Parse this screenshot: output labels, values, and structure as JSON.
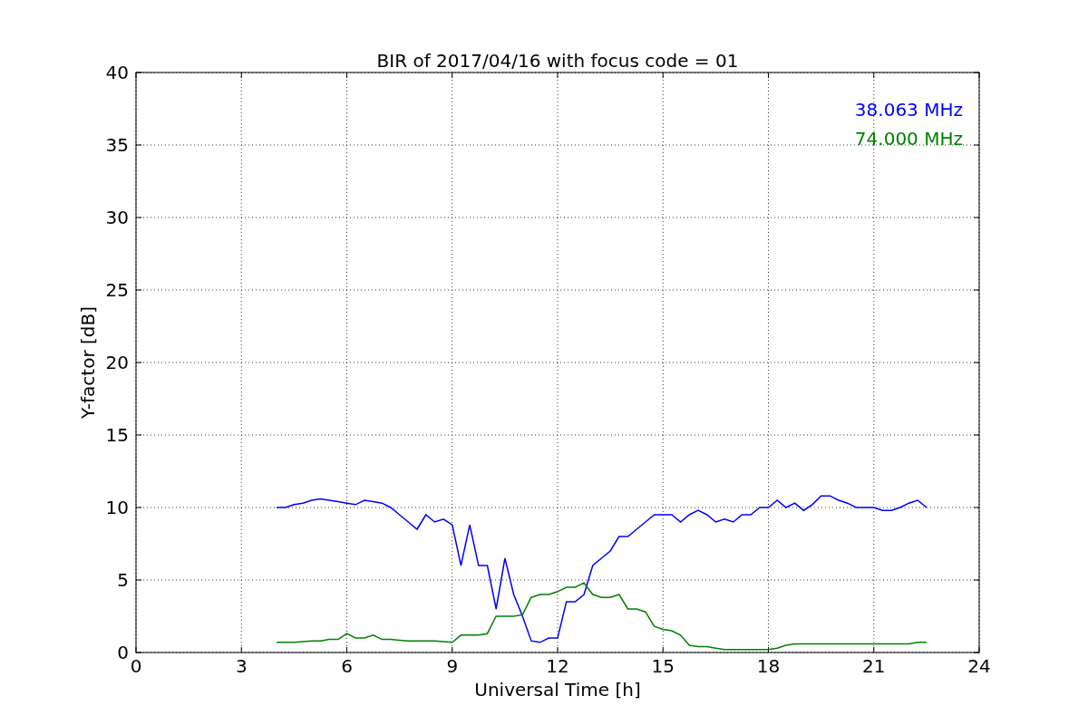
{
  "figure": {
    "chart_data": {
      "type": "line",
      "title": "BIR of 2017/04/16 with focus code = 01",
      "xlabel": "Universal Time [h]",
      "ylabel": "Y-factor [dB]",
      "x": [
        4,
        4.25,
        4.5,
        4.75,
        5,
        5.25,
        5.5,
        5.75,
        6,
        6.25,
        6.5,
        6.75,
        7,
        7.25,
        7.5,
        7.75,
        8,
        8.25,
        8.5,
        8.75,
        9,
        9.25,
        9.5,
        9.75,
        10,
        10.25,
        10.5,
        10.75,
        11,
        11.25,
        11.5,
        11.75,
        12,
        12.25,
        12.5,
        12.75,
        13,
        13.25,
        13.5,
        13.75,
        14,
        14.25,
        14.5,
        14.75,
        15,
        15.25,
        15.5,
        15.75,
        16,
        16.25,
        16.5,
        16.75,
        17,
        17.25,
        17.5,
        17.75,
        18,
        18.25,
        18.5,
        18.75,
        19,
        19.25,
        19.5,
        19.75,
        20,
        20.25,
        20.5,
        20.75,
        21,
        21.25,
        21.5,
        21.75,
        22,
        22.25,
        22.5
      ],
      "series": [
        {
          "name": "38.063 MHz",
          "color": "#0000ff",
          "values": [
            10,
            10,
            10.2,
            10.3,
            10.5,
            10.6,
            10.5,
            10.4,
            10.3,
            10.2,
            10.5,
            10.4,
            10.3,
            10,
            9.5,
            9,
            8.5,
            9.5,
            9,
            9.2,
            8.8,
            6,
            8.8,
            6,
            6,
            3,
            6.5,
            4,
            2.5,
            0.8,
            0.7,
            1,
            1,
            3.5,
            3.5,
            4,
            6,
            6.5,
            7,
            8,
            8,
            8.5,
            9,
            9.5,
            9.5,
            9.5,
            9,
            9.5,
            9.8,
            9.5,
            9,
            9.2,
            9,
            9.5,
            9.5,
            10,
            10,
            10.5,
            10,
            10.3,
            9.8,
            10.2,
            10.8,
            10.8,
            10.5,
            10.3,
            10,
            10,
            10,
            9.8,
            9.8,
            10,
            10.3,
            10.5,
            10
          ]
        },
        {
          "name": "74.000 MHz",
          "color": "#008000",
          "values": [
            0.7,
            0.7,
            0.7,
            0.75,
            0.8,
            0.8,
            0.9,
            0.9,
            1.3,
            1,
            1,
            1.2,
            0.9,
            0.9,
            0.85,
            0.8,
            0.8,
            0.8,
            0.8,
            0.75,
            0.7,
            1.2,
            1.2,
            1.2,
            1.3,
            2.5,
            2.5,
            2.5,
            2.6,
            3.8,
            4,
            4,
            4.2,
            4.5,
            4.5,
            4.8,
            4,
            3.8,
            3.8,
            4,
            3,
            3,
            2.8,
            1.8,
            1.6,
            1.5,
            1.2,
            0.5,
            0.4,
            0.4,
            0.3,
            0.2,
            0.2,
            0.2,
            0.2,
            0.2,
            0.2,
            0.3,
            0.5,
            0.6,
            0.6,
            0.6,
            0.6,
            0.6,
            0.6,
            0.6,
            0.6,
            0.6,
            0.6,
            0.6,
            0.6,
            0.6,
            0.6,
            0.7,
            0.7
          ]
        }
      ],
      "xlim": [
        0,
        24
      ],
      "ylim": [
        0,
        40
      ],
      "xticks": [
        0,
        3,
        6,
        9,
        12,
        15,
        18,
        21,
        24
      ],
      "yticks": [
        0,
        5,
        10,
        15,
        20,
        25,
        30,
        35,
        40
      ],
      "grid": true
    }
  }
}
